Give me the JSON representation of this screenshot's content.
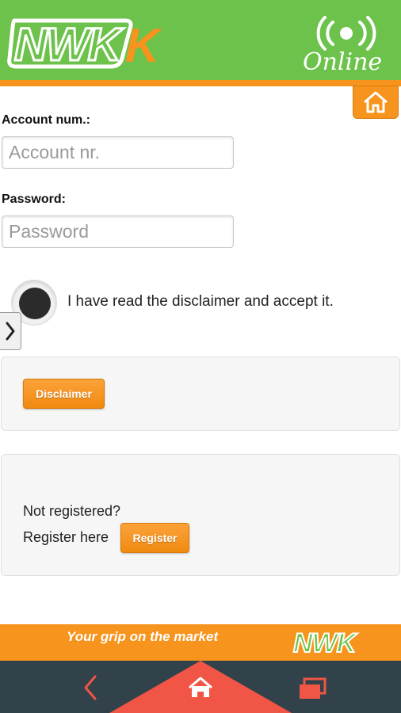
{
  "header": {
    "logo_text": "NWK",
    "online_text": "Online",
    "brand_green": "#6cc24a",
    "accent_orange": "#f7941d"
  },
  "home_button": {
    "icon": "home-icon"
  },
  "form": {
    "account_label": "Account num.:",
    "account_placeholder": "Account nr.",
    "password_label": "Password:",
    "password_placeholder": "Password",
    "accept_text": "I have read the disclaimer and accept it.",
    "side_tab_icon": "chevron-right-icon"
  },
  "disclaimer_panel": {
    "button_label": "Disclaimer"
  },
  "register_panel": {
    "question": "Not registered?",
    "register_text": "Register here",
    "button_label": "Register"
  },
  "footer": {
    "tagline": "Your grip on the market",
    "logo_text": "NWK"
  },
  "navbar": {
    "back_icon": "back-arrow-icon",
    "home_icon": "home-icon",
    "recent_icon": "recent-apps-icon",
    "bar_color": "#31424a",
    "accent_red": "#f05545"
  }
}
